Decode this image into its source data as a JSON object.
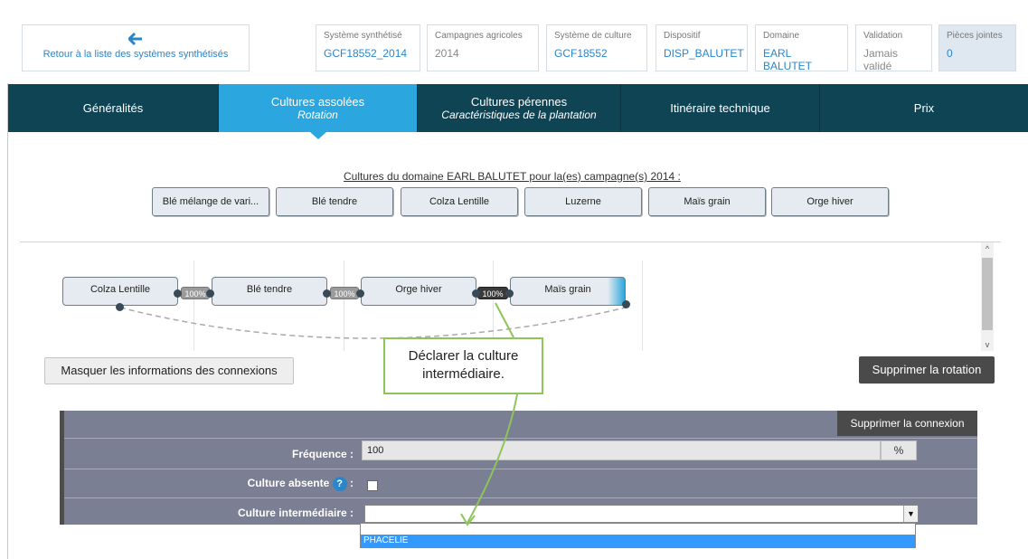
{
  "header": {
    "back_label": "Retour à la liste des systèmes synthétisés",
    "meta": [
      {
        "key": "Système synthétisé",
        "value": "GCF18552_2014",
        "link": true
      },
      {
        "key": "Campagnes agricoles",
        "value": "2014",
        "link": false
      },
      {
        "key": "Système de culture",
        "value": "GCF18552",
        "link": true
      },
      {
        "key": "Dispositif",
        "value": "DISP_BALUTET",
        "link": true
      },
      {
        "key": "Domaine",
        "value": "EARL BALUTET",
        "link": true
      },
      {
        "key": "Validation",
        "value": "Jamais validé",
        "link": false
      },
      {
        "key": "Pièces jointes",
        "value": "0",
        "link": true
      }
    ]
  },
  "tabs": [
    {
      "label": "Généralités",
      "sub": ""
    },
    {
      "label": "Cultures assolées",
      "sub": "Rotation"
    },
    {
      "label": "Cultures pérennes",
      "sub": "Caractéristiques de la plantation"
    },
    {
      "label": "Itinéraire technique",
      "sub": ""
    },
    {
      "label": "Prix",
      "sub": ""
    }
  ],
  "domain_cultures": {
    "title": "Cultures du domaine EARL BALUTET pour la(es) campagne(s) 2014 :",
    "items": [
      "Blé mélange de vari...",
      "Blé tendre",
      "Colza Lentille",
      "Luzerne",
      "Maïs grain",
      "Orge hiver"
    ]
  },
  "rotation": {
    "nodes": [
      "Colza Lentille",
      "Blé tendre",
      "Orge hiver",
      "Maïs grain"
    ],
    "connections": [
      "100%",
      "100%",
      "100%"
    ]
  },
  "buttons": {
    "hide_connections": "Masquer les informations des connexions",
    "delete_rotation": "Supprimer la rotation",
    "delete_connection": "Supprimer la connexion"
  },
  "callout": {
    "line1": "Déclarer la culture",
    "line2": "intermédiaire."
  },
  "connection_panel": {
    "frequency_label": "Fréquence :",
    "frequency_value": "100",
    "frequency_unit": "%",
    "absent_label": "Culture absente",
    "absent_suffix": ":",
    "help_icon": "?",
    "intermediate_label": "Culture intermédiaire :",
    "intermediate_value": "",
    "dropdown_option": "PHACELIE"
  },
  "scroll": {
    "up": "^",
    "down": "v"
  },
  "colors": {
    "tab_bar": "#0f4455",
    "tab_active": "#2ba6de",
    "link": "#2a86c9",
    "callout_border": "#8dc55a",
    "panel_bg": "#7a7f93"
  }
}
